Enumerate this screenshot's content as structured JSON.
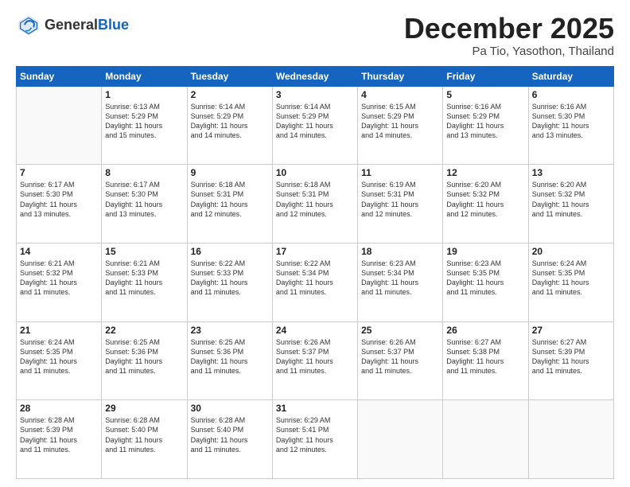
{
  "header": {
    "logo_general": "General",
    "logo_blue": "Blue",
    "month_title": "December 2025",
    "location": "Pa Tio, Yasothon, Thailand"
  },
  "weekdays": [
    "Sunday",
    "Monday",
    "Tuesday",
    "Wednesday",
    "Thursday",
    "Friday",
    "Saturday"
  ],
  "weeks": [
    [
      {
        "day": "",
        "info": ""
      },
      {
        "day": "1",
        "info": "Sunrise: 6:13 AM\nSunset: 5:29 PM\nDaylight: 11 hours\nand 15 minutes."
      },
      {
        "day": "2",
        "info": "Sunrise: 6:14 AM\nSunset: 5:29 PM\nDaylight: 11 hours\nand 14 minutes."
      },
      {
        "day": "3",
        "info": "Sunrise: 6:14 AM\nSunset: 5:29 PM\nDaylight: 11 hours\nand 14 minutes."
      },
      {
        "day": "4",
        "info": "Sunrise: 6:15 AM\nSunset: 5:29 PM\nDaylight: 11 hours\nand 14 minutes."
      },
      {
        "day": "5",
        "info": "Sunrise: 6:16 AM\nSunset: 5:29 PM\nDaylight: 11 hours\nand 13 minutes."
      },
      {
        "day": "6",
        "info": "Sunrise: 6:16 AM\nSunset: 5:30 PM\nDaylight: 11 hours\nand 13 minutes."
      }
    ],
    [
      {
        "day": "7",
        "info": "Sunrise: 6:17 AM\nSunset: 5:30 PM\nDaylight: 11 hours\nand 13 minutes."
      },
      {
        "day": "8",
        "info": "Sunrise: 6:17 AM\nSunset: 5:30 PM\nDaylight: 11 hours\nand 13 minutes."
      },
      {
        "day": "9",
        "info": "Sunrise: 6:18 AM\nSunset: 5:31 PM\nDaylight: 11 hours\nand 12 minutes."
      },
      {
        "day": "10",
        "info": "Sunrise: 6:18 AM\nSunset: 5:31 PM\nDaylight: 11 hours\nand 12 minutes."
      },
      {
        "day": "11",
        "info": "Sunrise: 6:19 AM\nSunset: 5:31 PM\nDaylight: 11 hours\nand 12 minutes."
      },
      {
        "day": "12",
        "info": "Sunrise: 6:20 AM\nSunset: 5:32 PM\nDaylight: 11 hours\nand 12 minutes."
      },
      {
        "day": "13",
        "info": "Sunrise: 6:20 AM\nSunset: 5:32 PM\nDaylight: 11 hours\nand 11 minutes."
      }
    ],
    [
      {
        "day": "14",
        "info": "Sunrise: 6:21 AM\nSunset: 5:32 PM\nDaylight: 11 hours\nand 11 minutes."
      },
      {
        "day": "15",
        "info": "Sunrise: 6:21 AM\nSunset: 5:33 PM\nDaylight: 11 hours\nand 11 minutes."
      },
      {
        "day": "16",
        "info": "Sunrise: 6:22 AM\nSunset: 5:33 PM\nDaylight: 11 hours\nand 11 minutes."
      },
      {
        "day": "17",
        "info": "Sunrise: 6:22 AM\nSunset: 5:34 PM\nDaylight: 11 hours\nand 11 minutes."
      },
      {
        "day": "18",
        "info": "Sunrise: 6:23 AM\nSunset: 5:34 PM\nDaylight: 11 hours\nand 11 minutes."
      },
      {
        "day": "19",
        "info": "Sunrise: 6:23 AM\nSunset: 5:35 PM\nDaylight: 11 hours\nand 11 minutes."
      },
      {
        "day": "20",
        "info": "Sunrise: 6:24 AM\nSunset: 5:35 PM\nDaylight: 11 hours\nand 11 minutes."
      }
    ],
    [
      {
        "day": "21",
        "info": "Sunrise: 6:24 AM\nSunset: 5:35 PM\nDaylight: 11 hours\nand 11 minutes."
      },
      {
        "day": "22",
        "info": "Sunrise: 6:25 AM\nSunset: 5:36 PM\nDaylight: 11 hours\nand 11 minutes."
      },
      {
        "day": "23",
        "info": "Sunrise: 6:25 AM\nSunset: 5:36 PM\nDaylight: 11 hours\nand 11 minutes."
      },
      {
        "day": "24",
        "info": "Sunrise: 6:26 AM\nSunset: 5:37 PM\nDaylight: 11 hours\nand 11 minutes."
      },
      {
        "day": "25",
        "info": "Sunrise: 6:26 AM\nSunset: 5:37 PM\nDaylight: 11 hours\nand 11 minutes."
      },
      {
        "day": "26",
        "info": "Sunrise: 6:27 AM\nSunset: 5:38 PM\nDaylight: 11 hours\nand 11 minutes."
      },
      {
        "day": "27",
        "info": "Sunrise: 6:27 AM\nSunset: 5:39 PM\nDaylight: 11 hours\nand 11 minutes."
      }
    ],
    [
      {
        "day": "28",
        "info": "Sunrise: 6:28 AM\nSunset: 5:39 PM\nDaylight: 11 hours\nand 11 minutes."
      },
      {
        "day": "29",
        "info": "Sunrise: 6:28 AM\nSunset: 5:40 PM\nDaylight: 11 hours\nand 11 minutes."
      },
      {
        "day": "30",
        "info": "Sunrise: 6:28 AM\nSunset: 5:40 PM\nDaylight: 11 hours\nand 11 minutes."
      },
      {
        "day": "31",
        "info": "Sunrise: 6:29 AM\nSunset: 5:41 PM\nDaylight: 11 hours\nand 12 minutes."
      },
      {
        "day": "",
        "info": ""
      },
      {
        "day": "",
        "info": ""
      },
      {
        "day": "",
        "info": ""
      }
    ]
  ]
}
